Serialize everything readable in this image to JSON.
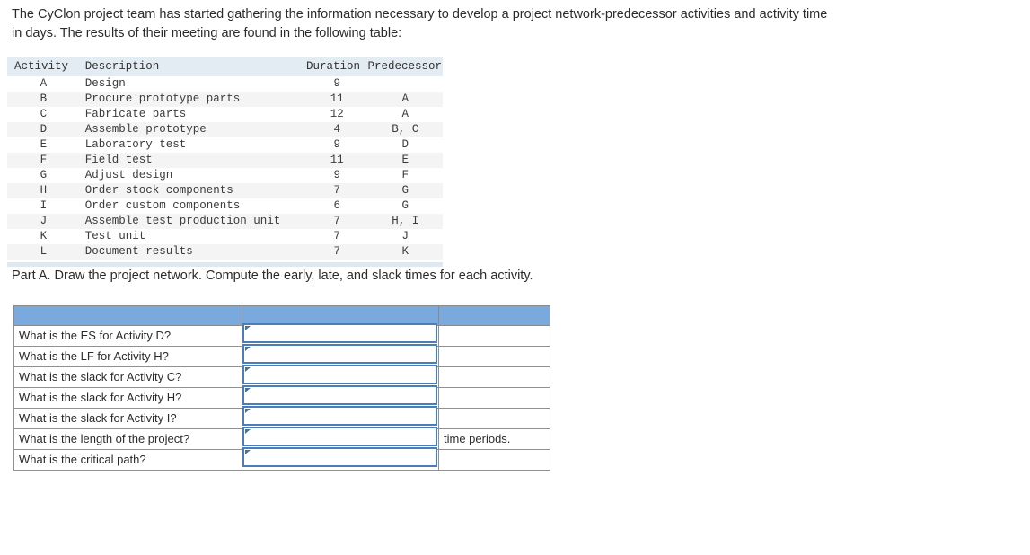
{
  "intro": {
    "paragraph": "The CyClon project team has started gathering the information necessary to develop a project network-predecessor activities and activity time in days. The results of their meeting are found in the following table:"
  },
  "activity_table": {
    "headers": {
      "activity": "Activity",
      "description": "Description",
      "duration": "Duration",
      "predecessor": "Predecessor"
    },
    "rows": [
      {
        "activity": "A",
        "description": "Design",
        "duration": "9",
        "predecessor": ""
      },
      {
        "activity": "B",
        "description": "Procure prototype parts",
        "duration": "11",
        "predecessor": "A"
      },
      {
        "activity": "C",
        "description": "Fabricate parts",
        "duration": "12",
        "predecessor": "A"
      },
      {
        "activity": "D",
        "description": "Assemble prototype",
        "duration": "4",
        "predecessor": "B, C"
      },
      {
        "activity": "E",
        "description": "Laboratory test",
        "duration": "9",
        "predecessor": "D"
      },
      {
        "activity": "F",
        "description": "Field test",
        "duration": "11",
        "predecessor": "E"
      },
      {
        "activity": "G",
        "description": "Adjust design",
        "duration": "9",
        "predecessor": "F"
      },
      {
        "activity": "H",
        "description": "Order stock components",
        "duration": "7",
        "predecessor": "G"
      },
      {
        "activity": "I",
        "description": "Order custom components",
        "duration": "6",
        "predecessor": "G"
      },
      {
        "activity": "J",
        "description": "Assemble test production unit",
        "duration": "7",
        "predecessor": "H, I"
      },
      {
        "activity": "K",
        "description": "Test unit",
        "duration": "7",
        "predecessor": "J"
      },
      {
        "activity": "L",
        "description": "Document results",
        "duration": "7",
        "predecessor": "K"
      }
    ]
  },
  "part_a": {
    "prompt": "Part A. Draw the project network. Compute the early, late, and slack times for each activity."
  },
  "answer_form": {
    "header_color": "#79a9dd",
    "input_border_color": "#4a7ebb",
    "rows": [
      {
        "question": "What is the ES for Activity D?",
        "value": "",
        "unit": ""
      },
      {
        "question": "What is the LF for Activity H?",
        "value": "",
        "unit": ""
      },
      {
        "question": "What is the slack for Activity C?",
        "value": "",
        "unit": ""
      },
      {
        "question": "What is the slack for Activity H?",
        "value": "",
        "unit": ""
      },
      {
        "question": "What is the slack for Activity I?",
        "value": "",
        "unit": ""
      },
      {
        "question": "What is the length of the project?",
        "value": "",
        "unit": "time periods."
      },
      {
        "question": "What is the critical path?",
        "value": "",
        "unit": ""
      }
    ]
  }
}
